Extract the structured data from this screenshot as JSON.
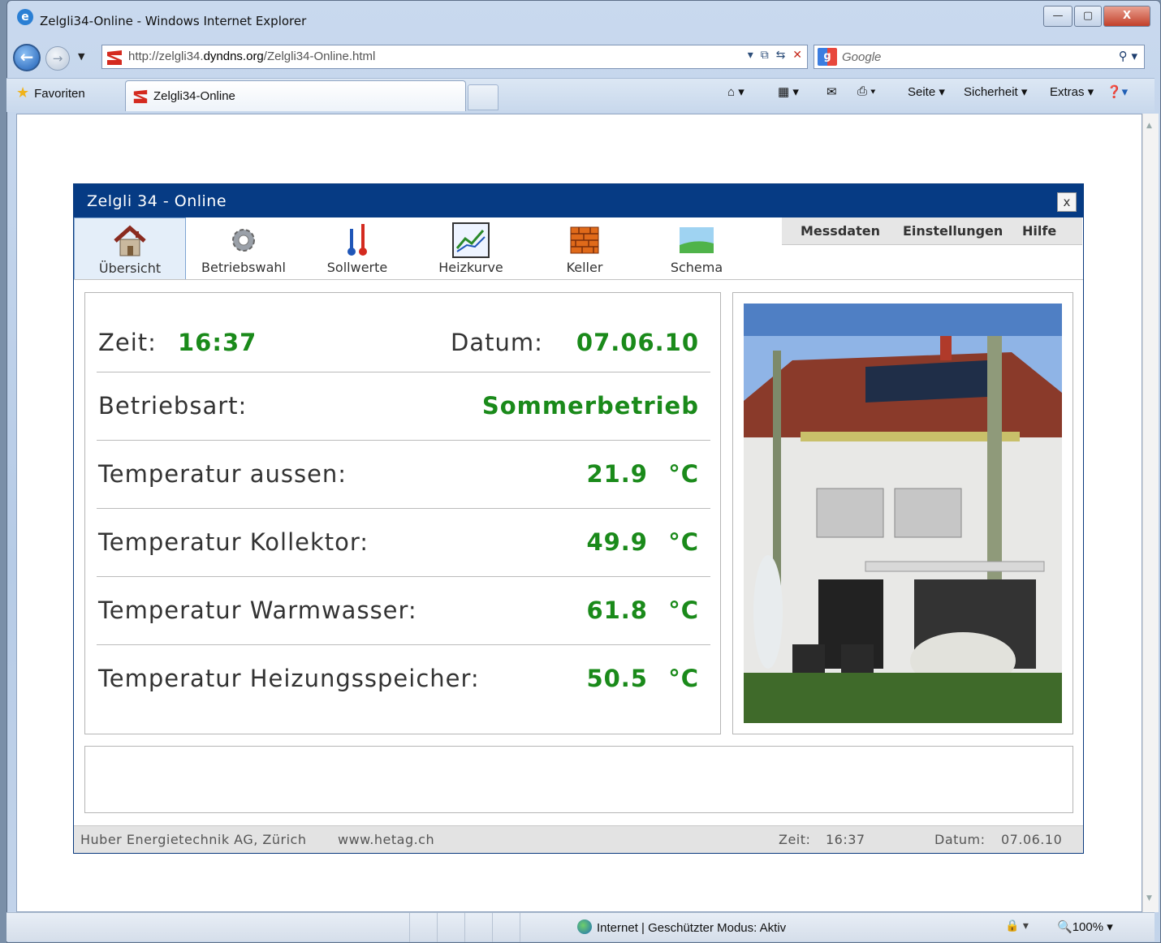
{
  "browser": {
    "window_title": "Zelgli34-Online - Windows Internet Explorer",
    "url_prefix": "http://zelgli34.",
    "url_host": "dyndns.org",
    "url_suffix": "/Zelgli34-Online.html",
    "search_placeholder": "Google",
    "favorites_label": "Favoriten",
    "tab_title": "Zelgli34-Online",
    "cmd_seite": "Seite ▾",
    "cmd_sicherheit": "Sicherheit ▾",
    "cmd_extras": "Extras ▾",
    "status_zone": "Internet | Geschützter Modus: Aktiv",
    "zoom": "100%"
  },
  "app": {
    "title": "Zelgli 34 - Online",
    "close_label": "x",
    "nav": [
      {
        "label": "Übersicht",
        "icon": "house-icon"
      },
      {
        "label": "Betriebswahl",
        "icon": "gear-icon"
      },
      {
        "label": "Sollwerte",
        "icon": "thermometer-icon"
      },
      {
        "label": "Heizkurve",
        "icon": "chart-icon"
      },
      {
        "label": "Keller",
        "icon": "brick-icon"
      },
      {
        "label": "Schema",
        "icon": "landscape-icon"
      }
    ],
    "menu": {
      "messdaten": "Messdaten",
      "einstellungen": "Einstellungen",
      "hilfe": "Hilfe"
    },
    "overview": {
      "zeit_label": "Zeit:",
      "zeit_value": "16:37",
      "datum_label": "Datum:",
      "datum_value": "07.06.10",
      "betriebsart_label": "Betriebsart:",
      "betriebsart_value": "Sommerbetrieb",
      "rows": [
        {
          "label": "Temperatur aussen:",
          "value": "21.9",
          "unit": "°C"
        },
        {
          "label": "Temperatur Kollektor:",
          "value": "49.9",
          "unit": "°C"
        },
        {
          "label": "Temperatur Warmwasser:",
          "value": "61.8",
          "unit": "°C"
        },
        {
          "label": "Temperatur Heizungsspeicher:",
          "value": "50.5",
          "unit": "°C"
        }
      ]
    },
    "footer": {
      "company": "Huber Energietechnik AG, Zürich",
      "website": "www.hetag.ch",
      "zeit_label": "Zeit:",
      "zeit_value": "16:37",
      "datum_label": "Datum:",
      "datum_value": "07.06.10"
    },
    "colors": {
      "header": "#063b84",
      "value_green": "#1a8a1a"
    }
  }
}
